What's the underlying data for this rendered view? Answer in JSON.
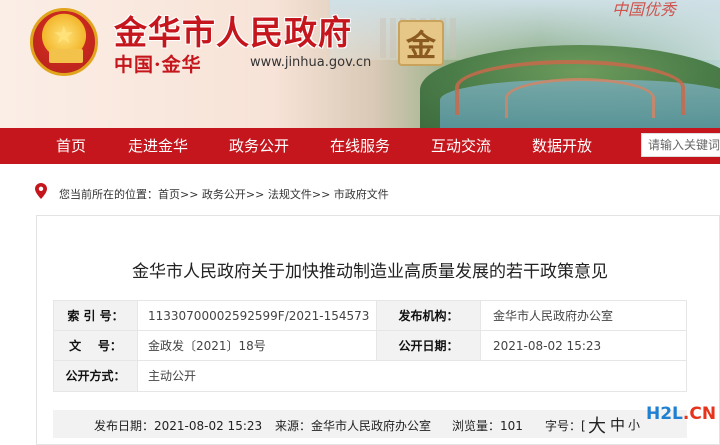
{
  "header": {
    "title": "金华市人民政府",
    "subtitle": "中国·金华",
    "url": "www.jinhua.gov.cn",
    "logo_char": "金",
    "slogan": "中国优秀",
    "brand_color": "#c4161c"
  },
  "nav": {
    "items": [
      "首页",
      "走进金华",
      "政务公开",
      "在线服务",
      "互动交流",
      "数据开放"
    ],
    "search_placeholder": "请输入关键词"
  },
  "breadcrumb": {
    "text": "您当前所在的位置：首页>> 政务公开>> 法规文件>> 市政府文件"
  },
  "article": {
    "title": "金华市人民政府关于加快推动制造业高质量发展的若干政策意见",
    "meta": {
      "index_label": "索 引 号：",
      "index_value": "11330700002592599F/2021-154573",
      "org_label": "发布机构：",
      "org_value": "金华市人民政府办公室",
      "docno_label": "文    号：",
      "docno_value": "金政发〔2021〕18号",
      "date_label": "公开日期：",
      "date_value": "2021-08-02 15:23",
      "mode_label": "公开方式：",
      "mode_value": "主动公开"
    },
    "pubbar": {
      "pubdate": "发布日期：2021-08-02 15:23",
      "source": "来源：金华市人民政府办公室",
      "views": "浏览量：101",
      "fontsize_label": "字号：[",
      "size_large": "大",
      "size_mid": "中",
      "size_small": "小"
    }
  },
  "watermark": {
    "h": "H2L",
    "dot": ".CN"
  }
}
